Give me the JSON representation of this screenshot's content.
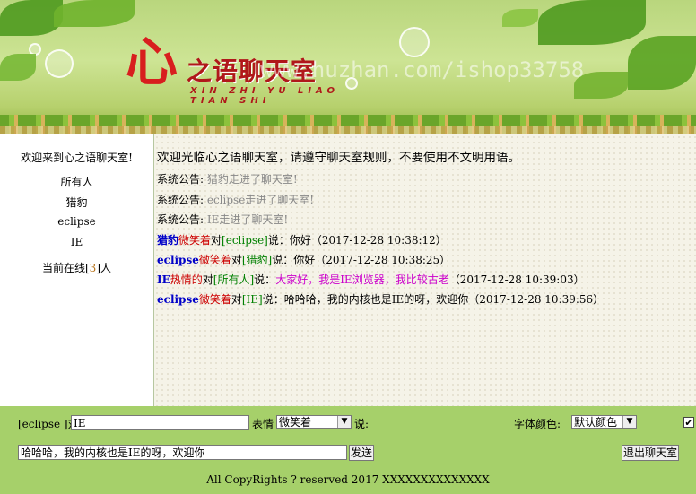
{
  "header": {
    "logo_heart": "心",
    "logo_title": "之语聊天室",
    "logo_pinyin": "XIN ZHI YU LIAO TIAN SHI",
    "watermark": "www.huzhan.com/ishop33758"
  },
  "sidebar": {
    "welcome": "欢迎来到心之语聊天室!",
    "users": [
      "所有人",
      "猎豹",
      "eclipse",
      "IE"
    ],
    "online_prefix": "当前在线[",
    "online_count": "3",
    "online_suffix": "]人"
  },
  "chat": {
    "welcome": "欢迎光临心之语聊天室，请遵守聊天室规则，不要使用不文明用语。",
    "notices": [
      {
        "prefix": "系统公告: ",
        "text": "猎豹走进了聊天室!"
      },
      {
        "prefix": "系统公告: ",
        "text": "eclipse走进了聊天室!"
      },
      {
        "prefix": "系统公告: ",
        "text": "IE走进了聊天室!"
      }
    ],
    "messages": [
      {
        "from": "猎豹",
        "expr": "微笑着",
        "to_word": "对",
        "to": "[eclipse]",
        "say": "说：",
        "text": "你好",
        "time": "（2017-12-28 10:38:12）"
      },
      {
        "from": "eclipse",
        "expr": "微笑着",
        "to_word": "对",
        "to": "[猎豹]",
        "say": "说：",
        "text": "你好",
        "time": "（2017-12-28 10:38:25）"
      },
      {
        "from": "IE",
        "expr": "热情的",
        "to_word": "对",
        "to": "[所有人]",
        "say": "说：",
        "text": "大家好，我是IE浏览器，我比较古老",
        "time": "（2017-12-28 10:39:03）"
      },
      {
        "from": "eclipse",
        "expr": "微笑着",
        "to_word": "对",
        "to": "[IE]",
        "say": "说：",
        "text": "哈哈哈，我的内核也是IE的呀，欢迎你",
        "time": "（2017-12-28 10:39:56）"
      }
    ]
  },
  "footer": {
    "sender_label": "[eclipse ]对",
    "target_value": "IE",
    "expr_label": "表情",
    "expr_value": "微笑着",
    "say_label": "说:",
    "font_color_label": "字体颜色:",
    "font_color_value": "默认颜色",
    "checkbox_checked": true,
    "message_value": "哈哈哈，我的内核也是IE的呀，欢迎你",
    "send_label": "发送",
    "exit_label": "退出聊天室",
    "copyright": "All CopyRights ? reserved 2017 XXXXXXXXXXXXXX"
  },
  "colors": {
    "header_green": "#b9d67d",
    "footer_green": "#a6d06a",
    "username_blue": "#0000c8",
    "expression_red": "#cc0000",
    "target_green": "#008000",
    "message_magenta": "#cc00cc",
    "online_count_orange": "#b8741a"
  }
}
